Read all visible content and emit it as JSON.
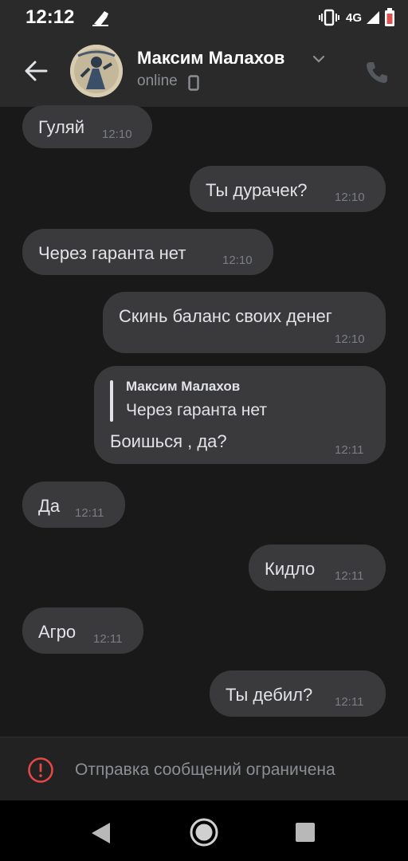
{
  "status_bar": {
    "time": "12:12",
    "network": "4G",
    "icons": [
      "vibrate-icon",
      "signal-icon",
      "battery-icon"
    ]
  },
  "header": {
    "contact_name": "Максим Малахов",
    "presence": "online"
  },
  "messages": [
    {
      "direction": "incoming",
      "text": "Гуляй",
      "time": "12:10"
    },
    {
      "direction": "outgoing",
      "text": "Ты дурачек?",
      "time": "12:10"
    },
    {
      "direction": "incoming",
      "text": "Через гаранта нет",
      "time": "12:10"
    },
    {
      "direction": "outgoing",
      "text": "Скинь баланс своих денег",
      "time": "12:10"
    },
    {
      "direction": "outgoing",
      "reply_author": "Максим Малахов",
      "reply_text": "Через гаранта нет",
      "text": "Боишься , да?",
      "time": "12:11"
    },
    {
      "direction": "incoming",
      "text": "Да",
      "time": "12:11"
    },
    {
      "direction": "outgoing",
      "text": "Кидло",
      "time": "12:11"
    },
    {
      "direction": "incoming",
      "text": "Агро",
      "time": "12:11"
    },
    {
      "direction": "outgoing",
      "text": "Ты дебил?",
      "time": "12:11"
    }
  ],
  "footer": {
    "restricted_text": "Отправка сообщений ограничена"
  },
  "colors": {
    "background": "#19191a",
    "bubble": "#3a3a3c",
    "header": "#2a2a2b",
    "alert": "#e64646"
  }
}
